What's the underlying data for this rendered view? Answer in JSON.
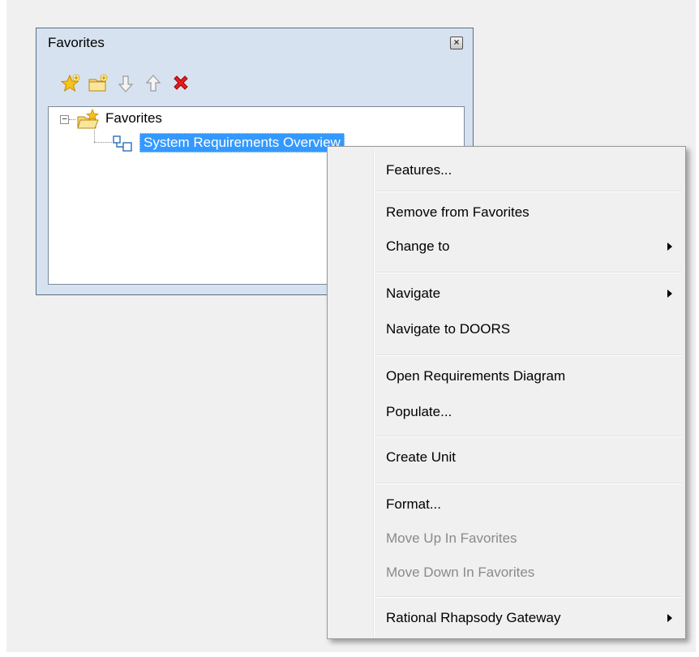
{
  "panel": {
    "title": "Favorites",
    "close_glyph": "×",
    "toolbar": [
      {
        "icon": "add-favorite-star-icon",
        "enabled": true
      },
      {
        "icon": "new-folder-icon",
        "enabled": true
      },
      {
        "icon": "move-down-arrow-icon",
        "enabled": false
      },
      {
        "icon": "move-up-arrow-icon",
        "enabled": false
      },
      {
        "icon": "delete-x-icon",
        "enabled": true
      }
    ],
    "tree": {
      "root_expander": "−",
      "root_label": "Favorites",
      "child_label": "System Requirements Overview"
    }
  },
  "menu": {
    "items": [
      {
        "label": "Features...",
        "enabled": true,
        "submenu": false
      },
      {
        "label": "Remove from Favorites",
        "enabled": true,
        "submenu": false
      },
      {
        "label": "Change to",
        "enabled": true,
        "submenu": true
      },
      {
        "label": "Navigate",
        "enabled": true,
        "submenu": true
      },
      {
        "label": "Navigate to DOORS",
        "enabled": true,
        "submenu": false
      },
      {
        "label": "Open Requirements Diagram",
        "enabled": true,
        "submenu": false
      },
      {
        "label": "Populate...",
        "enabled": true,
        "submenu": false
      },
      {
        "label": "Create Unit",
        "enabled": true,
        "submenu": false
      },
      {
        "label": "Format...",
        "enabled": true,
        "submenu": false
      },
      {
        "label": "Move Up In Favorites",
        "enabled": false,
        "submenu": false
      },
      {
        "label": "Move Down In Favorites",
        "enabled": false,
        "submenu": false
      },
      {
        "label": "Rational Rhapsody Gateway",
        "enabled": true,
        "submenu": true
      }
    ]
  },
  "colors": {
    "selection": "#3399ff",
    "panel_bg": "#d6e2ef",
    "menu_bg": "#f0f0f0",
    "disabled_text": "#8a8a8a"
  }
}
